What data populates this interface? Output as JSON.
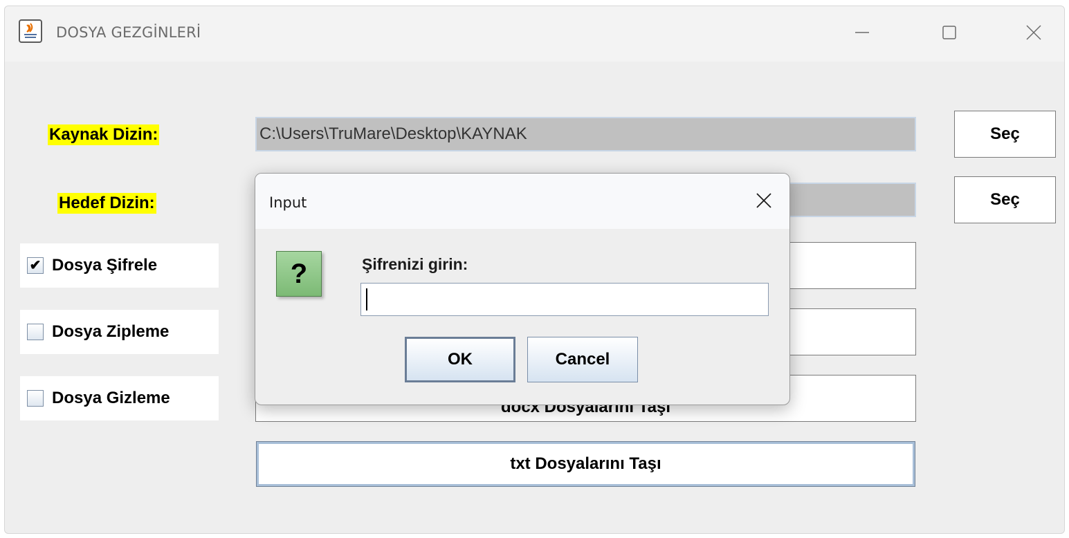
{
  "window": {
    "title": "DOSYA GEZGİNLERİ",
    "controls": [
      "minimize-icon",
      "maximize-icon",
      "close-icon"
    ]
  },
  "form": {
    "source_label": "Kaynak Dizin:",
    "source_value": "C:\\Users\\TruMare\\Desktop\\KAYNAK",
    "source_button": "Seç",
    "target_label": "Hedef Dizin:",
    "target_value": "",
    "target_button": "Seç"
  },
  "options": [
    {
      "label": "Dosya Şifrele",
      "checked": true,
      "check_glyph": "✔"
    },
    {
      "label": "Dosya Zipleme",
      "checked": false,
      "check_glyph": ""
    },
    {
      "label": "Dosya Gizleme",
      "checked": false,
      "check_glyph": ""
    }
  ],
  "actions": {
    "button1": "",
    "button2": "",
    "button3": "docx Dosyalarını Taşı",
    "txt_button": "txt Dosyalarını Taşı"
  },
  "dialog": {
    "title": "Input",
    "icon_glyph": "?",
    "prompt": "Şifrenizi girin:",
    "input_value": "",
    "ok_label": "OK",
    "cancel_label": "Cancel"
  },
  "colors": {
    "label_highlight": "#ffff00",
    "field_gray": "#c0c0c0",
    "question_green": "#8cc884"
  }
}
